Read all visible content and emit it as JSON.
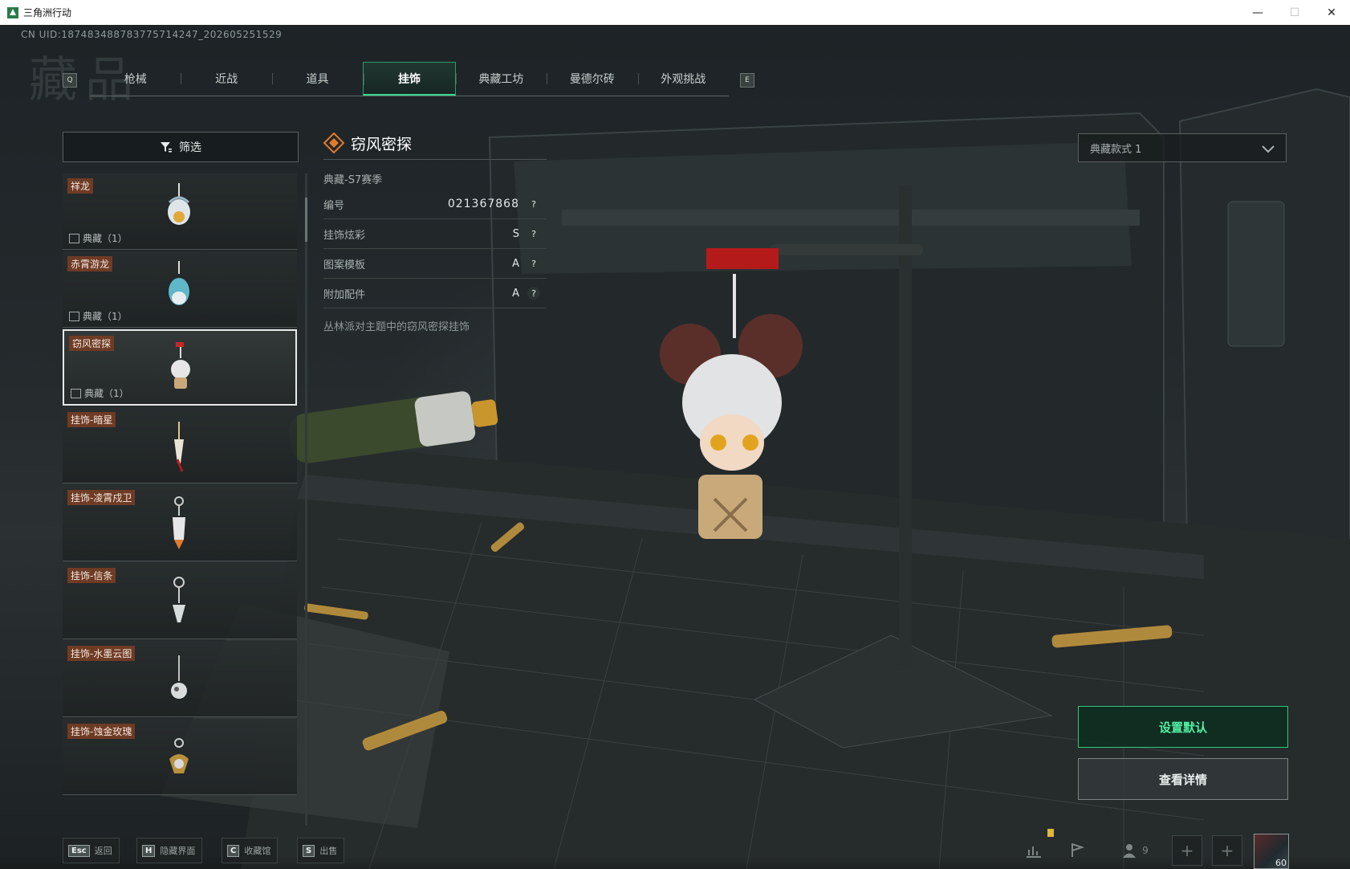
{
  "window": {
    "title": "三角洲行动"
  },
  "header": {
    "uid": "CN UID:187483488783775714247_202605251529",
    "page_title": "藏品",
    "left_key": "Q",
    "right_key": "E"
  },
  "tabs": [
    {
      "label": "枪械",
      "active": false
    },
    {
      "label": "近战",
      "active": false
    },
    {
      "label": "道具",
      "active": false
    },
    {
      "label": "挂饰",
      "active": true
    },
    {
      "label": "典藏工坊",
      "active": false
    },
    {
      "label": "曼德尔砖",
      "active": false
    },
    {
      "label": "外观挑战",
      "active": false
    }
  ],
  "filter": {
    "label": "筛选"
  },
  "items": [
    {
      "name": "祥龙",
      "count": "典藏（1）",
      "selected": false
    },
    {
      "name": "赤霄游龙",
      "count": "典藏（1）",
      "selected": false
    },
    {
      "name": "窃风密探",
      "count": "典藏（1）",
      "selected": true
    },
    {
      "name": "挂饰-暗星",
      "count": "",
      "selected": false
    },
    {
      "name": "挂饰-凌霄戍卫",
      "count": "",
      "selected": false
    },
    {
      "name": "挂饰-信条",
      "count": "",
      "selected": false
    },
    {
      "name": "挂饰-水墨云图",
      "count": "",
      "selected": false
    },
    {
      "name": "挂饰-蚀金玫瑰",
      "count": "",
      "selected": false
    }
  ],
  "detail": {
    "name": "窃风密探",
    "season": "典藏-S7赛季",
    "rows": [
      {
        "label": "编号",
        "value": "021367868"
      },
      {
        "label": "挂饰炫彩",
        "value": "S"
      },
      {
        "label": "图案模板",
        "value": "A"
      },
      {
        "label": "附加配件",
        "value": "A"
      }
    ],
    "description": "丛林派对主题中的窃风密探挂饰"
  },
  "style_select": {
    "value": "典藏款式 1"
  },
  "actions": {
    "set_default": "设置默认",
    "view_details": "查看详情"
  },
  "bottom_hints": [
    {
      "key": "Esc",
      "label": "返回"
    },
    {
      "key": "H",
      "label": "隐藏界面"
    },
    {
      "key": "C",
      "label": "收藏馆"
    },
    {
      "key": "S",
      "label": "出售"
    }
  ],
  "hud": {
    "party_count": "9",
    "level": "60"
  },
  "colors": {
    "accent": "#3dd58f",
    "name_tag": "#6e3b25",
    "brand_orange": "#e07a2e"
  },
  "icons": {
    "filter": "filter-icon",
    "detail_title": "diamond-icon",
    "chevron": "chevron-down-icon",
    "help": "question-icon"
  }
}
